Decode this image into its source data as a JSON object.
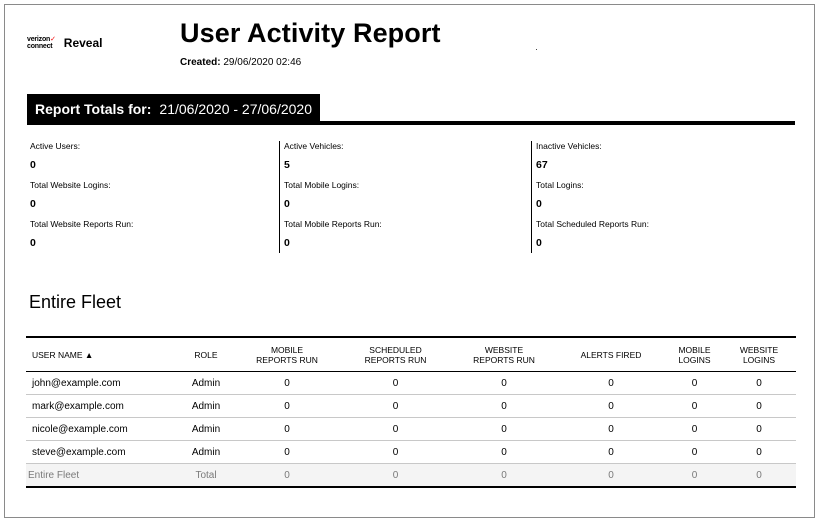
{
  "logo": {
    "brand_line1": "verizon",
    "brand_check": "✓",
    "brand_line2": "connect",
    "product": "Reveal"
  },
  "header": {
    "title": "User Activity Report",
    "created_label": "Created:",
    "created_value": "29/06/2020 02:46"
  },
  "totals": {
    "label": "Report Totals for:",
    "range": "21/06/2020 - 27/06/2020"
  },
  "stats": {
    "col1": [
      {
        "label": "Active Users:",
        "value": "0"
      },
      {
        "label": "Total Website Logins:",
        "value": "0"
      },
      {
        "label": "Total Website Reports Run:",
        "value": "0"
      }
    ],
    "col2": [
      {
        "label": "Active Vehicles:",
        "value": "5"
      },
      {
        "label": "Total Mobile Logins:",
        "value": "0"
      },
      {
        "label": "Total Mobile Reports Run:",
        "value": "0"
      }
    ],
    "col3": [
      {
        "label": "Inactive Vehicles:",
        "value": "67"
      },
      {
        "label": "Total Logins:",
        "value": "0"
      },
      {
        "label": "Total Scheduled Reports Run:",
        "value": "0"
      }
    ]
  },
  "fleet": {
    "title": "Entire Fleet"
  },
  "table": {
    "headers": {
      "user": "USER NAME ▲",
      "role": "ROLE",
      "mobile_reports_1": "MOBILE",
      "mobile_reports_2": "REPORTS RUN",
      "scheduled_reports_1": "SCHEDULED",
      "scheduled_reports_2": "REPORTS RUN",
      "website_reports_1": "WEBSITE",
      "website_reports_2": "REPORTS RUN",
      "alerts": "ALERTS FIRED",
      "mobile_logins_1": "MOBILE",
      "mobile_logins_2": "LOGINS",
      "website_logins_1": "WEBSITE",
      "website_logins_2": "LOGINS"
    },
    "rows": [
      {
        "user": "john@example.com",
        "role": "Admin",
        "mobile_reports": "0",
        "scheduled_reports": "0",
        "website_reports": "0",
        "alerts": "0",
        "mobile_logins": "0",
        "website_logins": "0"
      },
      {
        "user": "mark@example.com",
        "role": "Admin",
        "mobile_reports": "0",
        "scheduled_reports": "0",
        "website_reports": "0",
        "alerts": "0",
        "mobile_logins": "0",
        "website_logins": "0"
      },
      {
        "user": "nicole@example.com",
        "role": "Admin",
        "mobile_reports": "0",
        "scheduled_reports": "0",
        "website_reports": "0",
        "alerts": "0",
        "mobile_logins": "0",
        "website_logins": "0"
      },
      {
        "user": "steve@example.com",
        "role": "Admin",
        "mobile_reports": "0",
        "scheduled_reports": "0",
        "website_reports": "0",
        "alerts": "0",
        "mobile_logins": "0",
        "website_logins": "0"
      }
    ],
    "total": {
      "user": "Entire Fleet",
      "role": "Total",
      "mobile_reports": "0",
      "scheduled_reports": "0",
      "website_reports": "0",
      "alerts": "0",
      "mobile_logins": "0",
      "website_logins": "0"
    }
  }
}
